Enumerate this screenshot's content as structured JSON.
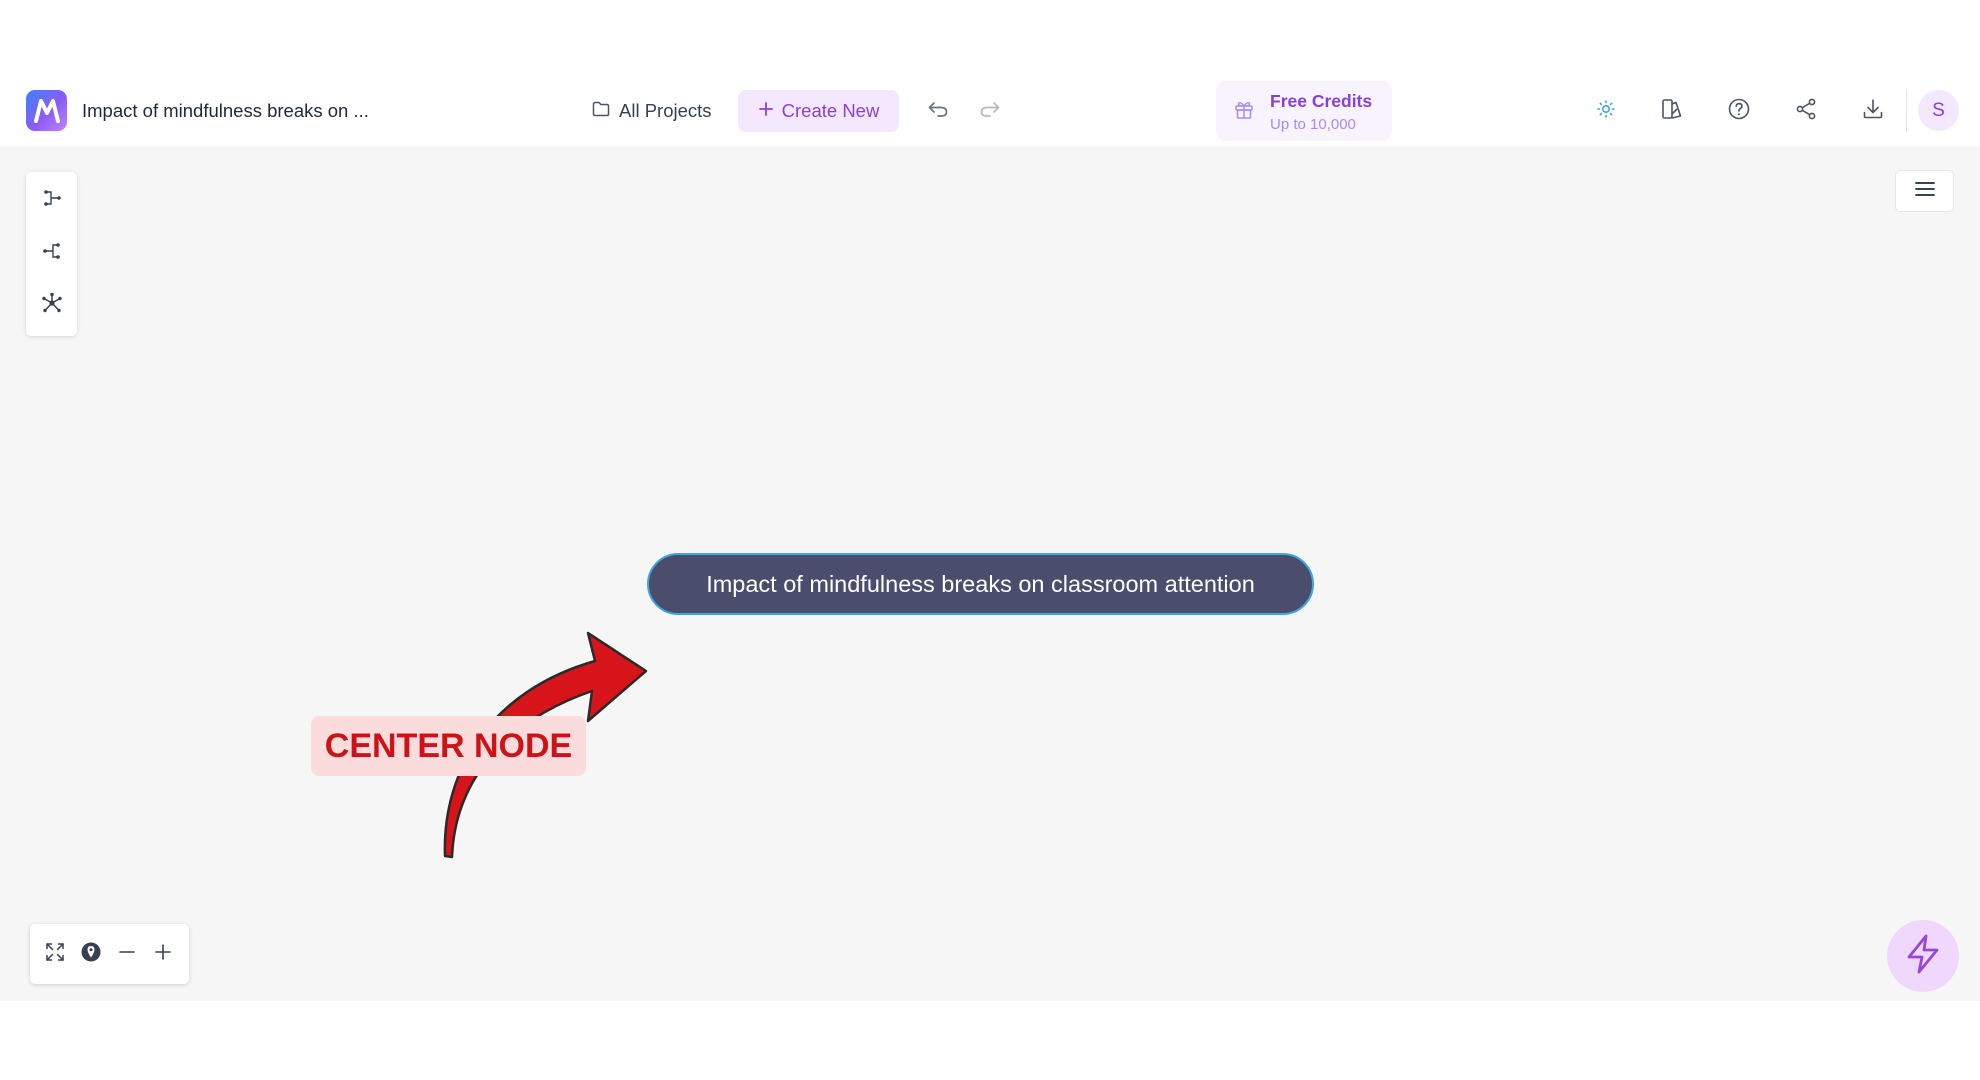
{
  "header": {
    "title": "Impact of mindfulness breaks on ...",
    "all_projects_label": "All Projects",
    "create_new_label": "Create New",
    "credits": {
      "title": "Free Credits",
      "subtitle": "Up to 10,000"
    },
    "avatar_initial": "S"
  },
  "canvas": {
    "center_node_text": "Impact of mindfulness breaks on classroom attention",
    "annotation_label": "CENTER NODE"
  },
  "icons": {
    "logo": "app-logo-icon",
    "folder": "folder-icon",
    "plus": "plus-icon",
    "undo": "undo-icon",
    "redo": "redo-icon",
    "gift": "gift-icon",
    "theme": "sun-icon",
    "style": "theme-style-icon",
    "help": "help-icon",
    "share": "share-icon",
    "download": "download-icon",
    "menu": "hamburger-icon",
    "layout_right": "layout-right-icon",
    "layout_left": "layout-left-icon",
    "layout_radial": "layout-radial-icon",
    "fit": "fit-screen-icon",
    "locate": "locate-icon",
    "zoom_out": "zoom-out-icon",
    "zoom_in": "zoom-in-icon",
    "ai": "lightning-icon"
  },
  "colors": {
    "accent": "#8b3fd6",
    "node_fill": "#4a4d6c",
    "node_border": "#3fa6e3",
    "annotation_red": "#cc1418",
    "annotation_bg": "#fbdcdc",
    "canvas_bg": "#f6f6f6"
  }
}
